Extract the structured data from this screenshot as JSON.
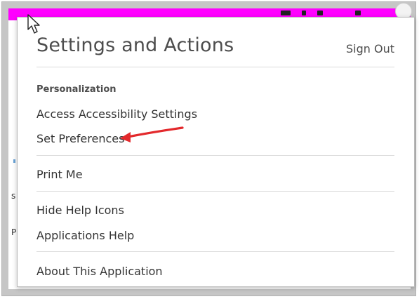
{
  "popup": {
    "title": "Settings and Actions",
    "sign_out_label": "Sign Out",
    "personalization": {
      "heading": "Personalization",
      "items": [
        {
          "label": "Access Accessibility Settings"
        },
        {
          "label": "Set Preferences"
        }
      ]
    },
    "print_group": {
      "items": [
        {
          "label": "Print Me"
        }
      ]
    },
    "help_group": {
      "items": [
        {
          "label": "Hide Help Icons"
        },
        {
          "label": "Applications Help"
        }
      ]
    },
    "about_group": {
      "items": [
        {
          "label": "About This Application"
        }
      ]
    }
  },
  "background": {
    "left_text_1": "s",
    "left_text_2": "P"
  },
  "colors": {
    "top_bar": "#ff00ff",
    "annotation_arrow": "#e3292c",
    "frame": "#c6c6c6",
    "orange_tab": "#f4a23a"
  },
  "icons": {
    "cursor": "mouse-pointer-icon",
    "annotation": "red-arrow-icon"
  }
}
